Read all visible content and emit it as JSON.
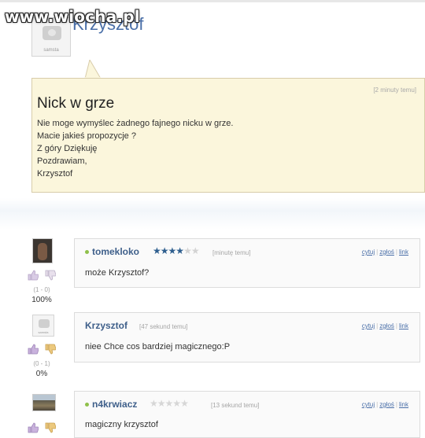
{
  "watermark": "www.wiocha.pl",
  "post": {
    "author": "Krzysztof",
    "author_avatar_label": "samsta",
    "timestamp": "[2 minuty temu]",
    "title": "Nick w grze",
    "body_lines": [
      "Nie moge wymyślec żadnego fajnego nicku w grze.",
      "Macie jakieś propozycje ?",
      "Z góry Dziękuję",
      "Pozdrawiam,",
      "Krzysztof"
    ]
  },
  "comments": [
    {
      "author": "tomekloko",
      "stars": 3.5,
      "stars_max": 5,
      "timestamp": "[minutę temu]",
      "text": "może Krzysztof?",
      "votes": "(1 - 0)",
      "percent": "100%",
      "avatar": "dark-photo"
    },
    {
      "author": "Krzysztof",
      "timestamp": "[47 sekund temu]",
      "text": "niee Chce cos bardziej magicznego:P",
      "votes": "(0 - 1)",
      "percent": "0%",
      "avatar_label": "samsta"
    },
    {
      "author": "n4krwiacz",
      "stars": 0,
      "stars_max": 5,
      "timestamp": "[13 sekund temu]",
      "text": "magiczny krzysztof",
      "avatar": "landscape-photo"
    }
  ],
  "actions": {
    "quote": "cytuj",
    "report": "zgłoś",
    "link": "link"
  },
  "colors": {
    "post_bg": "#fbf6dc",
    "link": "#4a6fa8",
    "online_dot": "#8fc04a",
    "star_filled": "#2f5f8f",
    "thumb_up": "#c8b6d8",
    "thumb_down": "#e5c68a"
  }
}
